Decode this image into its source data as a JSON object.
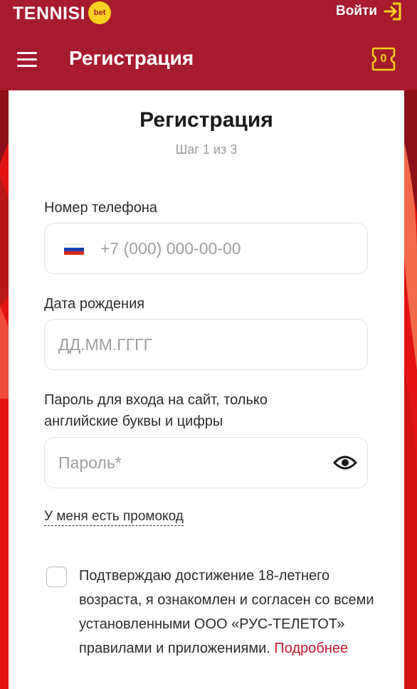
{
  "brand": {
    "name": "TENNISI",
    "badge": "bet"
  },
  "header": {
    "login_label": "Войти",
    "title": "Регистрация",
    "coupon_count": "0"
  },
  "form": {
    "title": "Регистрация",
    "step": "Шаг 1 из 3",
    "phone": {
      "label": "Номер телефона",
      "placeholder": "+7 (000) 000-00-00"
    },
    "birthdate": {
      "label": "Дата рождения",
      "placeholder": "ДД.ММ.ГГГГ"
    },
    "password": {
      "label": "Пароль для входа на сайт, только английские буквы и цифры",
      "placeholder": "Пароль*"
    },
    "promo_link": "У меня есть промокод",
    "consent": {
      "text": "Подтверждаю достижение 18-летнего возраста, я ознакомлен и согласен со всеми установленными ООО «РУС-ТЕЛЕТОТ» правилами и приложениями.",
      "more_link": "Подробнее"
    }
  },
  "colors": {
    "header_bg": "#a61b2e",
    "page_bg": "#e31313",
    "accent_yellow": "#f7d11e",
    "link_red": "#c2162b"
  },
  "icons": {
    "login": "login-arrow-icon",
    "menu": "hamburger-menu-icon",
    "coupon": "bet-slip-icon",
    "flag": "russia-flag-icon",
    "password_toggle": "eye-icon"
  }
}
